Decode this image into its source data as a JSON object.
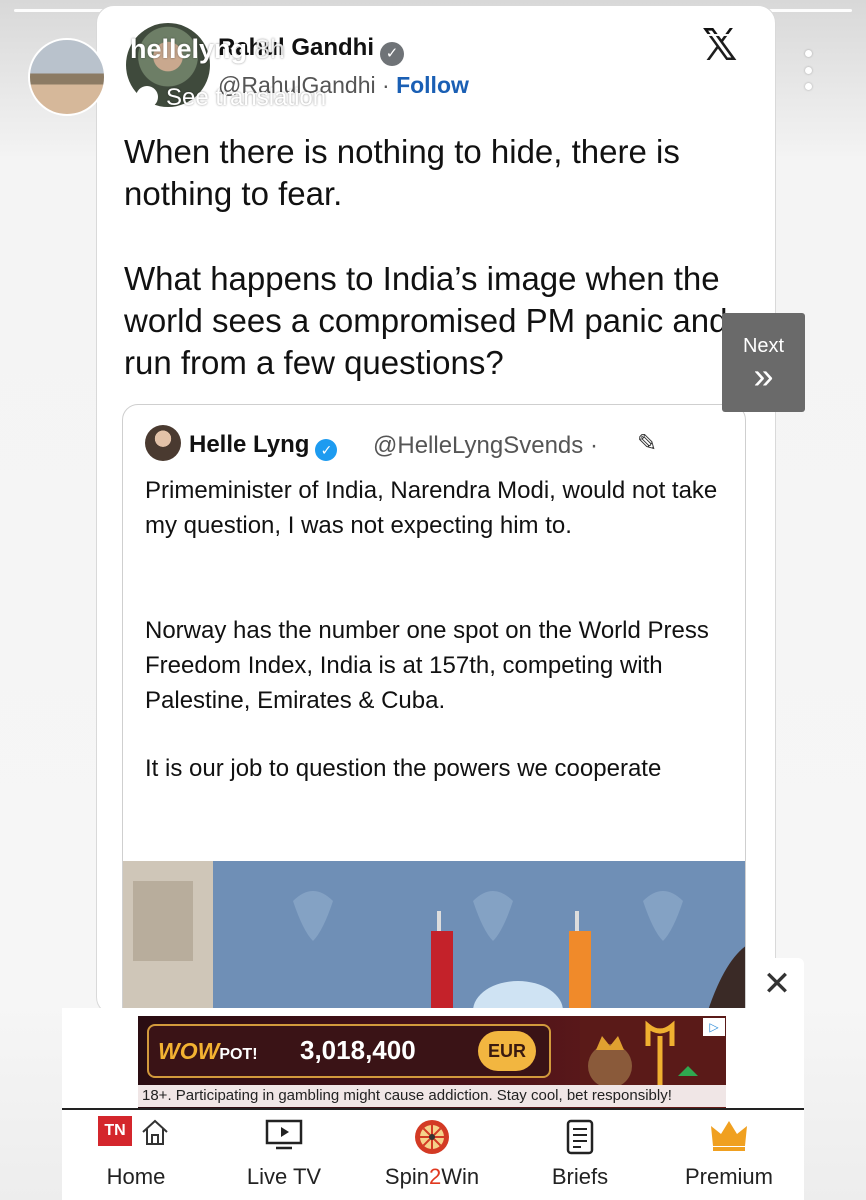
{
  "story": {
    "username": "hellelyng",
    "time": "8h",
    "see_translation": "See translation",
    "follow_label": "Follow",
    "next_label": "Next",
    "next_chevron": "»"
  },
  "tweet": {
    "author_name": "Rahul Gandhi",
    "author_handle": "@RahulGandhi",
    "follow_text": "Follow",
    "separator": "·",
    "x_logo": "𝕏",
    "paragraph1": "When there is nothing to hide, there is nothing to fear.",
    "paragraph2": "What happens to India’s image when the world sees a compromised PM panic and run from a few questions?"
  },
  "quoted_tweet": {
    "author_name": "Helle Lyng",
    "author_handle": "@HelleLyngSvends",
    "separator": "·",
    "edit_icon": "✎",
    "paragraph1": "Primeminister of India, Narendra Modi, would not take my question, I was not expecting him to.",
    "paragraph2": "Norway has the number one spot on the World Press Freedom Index, India is at 157th, competing with Palestine, Emirates & Cuba.",
    "paragraph3": "It is our job to question the powers we cooperate"
  },
  "ad": {
    "close_symbol": "✕",
    "brand_main": "WOW",
    "brand_sub": "POT!",
    "jackpot_amount": "3,018,400",
    "currency": "EUR",
    "ad_choice": "▷",
    "disclaimer": "18+. Participating in gambling might cause addiction. Stay cool, bet responsibly!"
  },
  "bottom_nav": {
    "logo_text": "TN",
    "home": "Home",
    "live_tv": "Live TV",
    "spin_prefix": "Spin",
    "spin_number": "2",
    "spin_suffix": "Win",
    "briefs": "Briefs",
    "premium": "Premium"
  },
  "colors": {
    "follow_blue": "#1a5fb4",
    "verified_blue": "#1d9bf0",
    "ad_gold": "#f2b640",
    "premium_gold": "#f0a020",
    "spin_red": "#e0381f",
    "tn_red": "#d4262c"
  },
  "icons": {
    "home": "home-icon",
    "live_tv": "tv-icon",
    "spin": "wheel-icon",
    "briefs": "document-icon",
    "premium": "crown-icon"
  }
}
